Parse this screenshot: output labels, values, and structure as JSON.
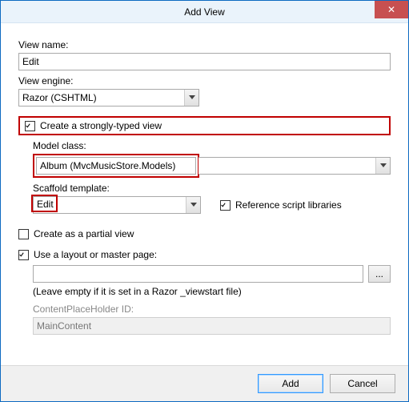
{
  "window": {
    "title": "Add View",
    "close_glyph": "✕"
  },
  "viewName": {
    "label": "View name:",
    "value": "Edit"
  },
  "viewEngine": {
    "label": "View engine:",
    "value": "Razor (CSHTML)"
  },
  "stronglyTyped": {
    "label": "Create a strongly-typed view",
    "checked": true
  },
  "modelClass": {
    "label": "Model class:",
    "value": "Album (MvcMusicStore.Models)"
  },
  "scaffold": {
    "label": "Scaffold template:",
    "value": "Edit"
  },
  "refScripts": {
    "label": "Reference script libraries",
    "checked": true
  },
  "partialView": {
    "label": "Create as a partial view",
    "checked": false
  },
  "useLayout": {
    "label": "Use a layout or master page:",
    "checked": true
  },
  "layoutPath": {
    "value": ""
  },
  "layoutHint": "(Leave empty if it is set in a Razor _viewstart file)",
  "cphId": {
    "label": "ContentPlaceHolder ID:",
    "value": "MainContent"
  },
  "browse": "...",
  "buttons": {
    "ok": "Add",
    "cancel": "Cancel"
  }
}
